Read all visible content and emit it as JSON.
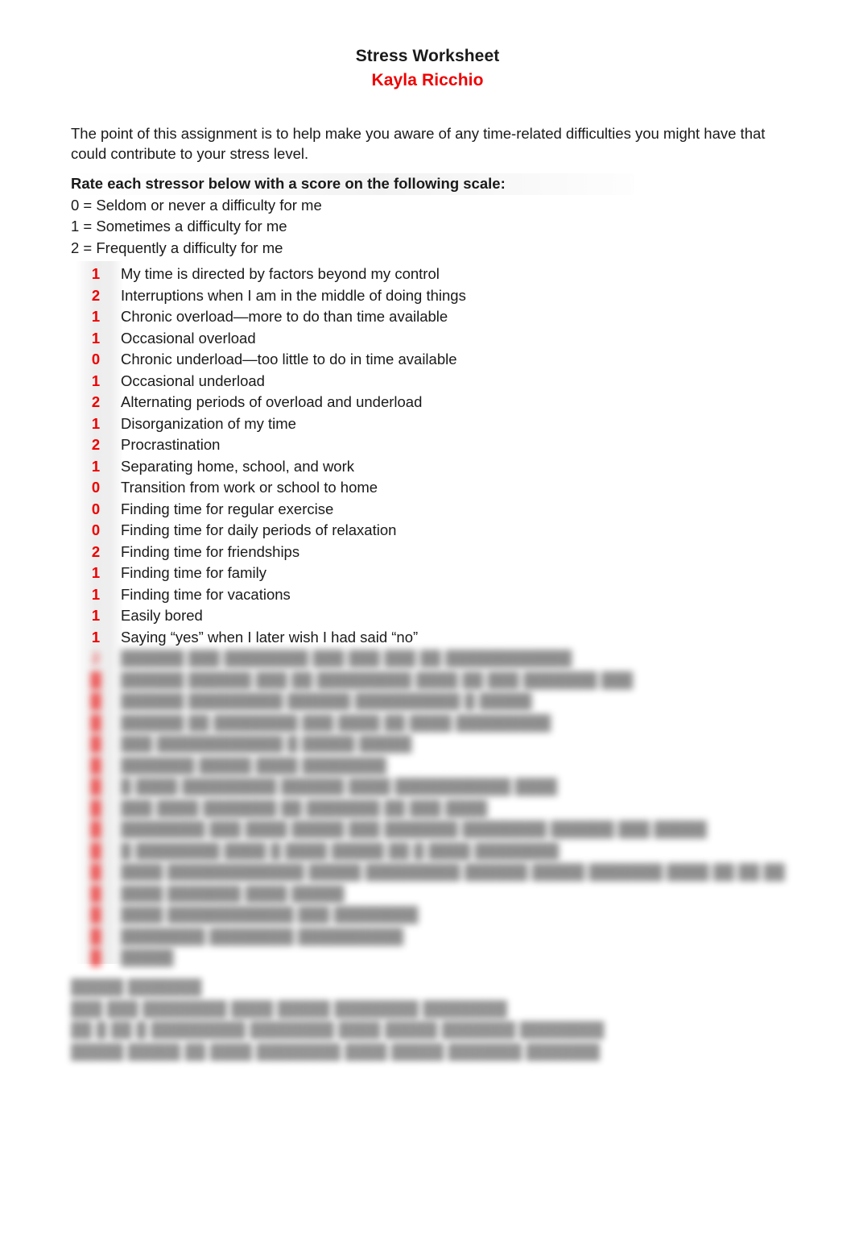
{
  "document": {
    "title": "Stress Worksheet",
    "author": "Kayla Ricchio",
    "intro": "The point of this assignment is to help make you aware of any time-related difficulties you might have that could contribute to your stress level.",
    "scale": {
      "heading": "Rate each stressor below with a score on the following scale:",
      "options": [
        "0 = Seldom or never a difficulty for me",
        "1 = Sometimes a difficulty for me",
        "2 = Frequently a difficulty for me"
      ]
    },
    "colors": {
      "score_red": "#ee0000",
      "author_red": "#ee0000",
      "body_text": "#1a1a1a",
      "page_background": "#ffffff",
      "score_column_shade": "#e7e7e7"
    },
    "stressors": [
      {
        "score": "1",
        "label": "My time is directed by factors beyond my control",
        "redacted": false
      },
      {
        "score": "2",
        "label": "Interruptions when I am in the middle of doing things",
        "redacted": false
      },
      {
        "score": "1",
        "label": "Chronic overload—more to do than time available",
        "redacted": false
      },
      {
        "score": "1",
        "label": "Occasional overload",
        "redacted": false
      },
      {
        "score": "0",
        "label": "Chronic underload—too little to do in time available",
        "redacted": false
      },
      {
        "score": "1",
        "label": "Occasional underload",
        "redacted": false
      },
      {
        "score": "2",
        "label": "Alternating periods of overload and underload",
        "redacted": false
      },
      {
        "score": "1",
        "label": "Disorganization of my time",
        "redacted": false
      },
      {
        "score": "2",
        "label": "Procrastination",
        "redacted": false
      },
      {
        "score": "1",
        "label": "Separating home, school, and work",
        "redacted": false
      },
      {
        "score": "0",
        "label": "Transition from work or school to home",
        "redacted": false
      },
      {
        "score": "0",
        "label": "Finding time for regular exercise",
        "redacted": false
      },
      {
        "score": "0",
        "label": "Finding time for daily periods of relaxation",
        "redacted": false
      },
      {
        "score": "2",
        "label": "Finding time for friendships",
        "redacted": false
      },
      {
        "score": "1",
        "label": "Finding time for family",
        "redacted": false
      },
      {
        "score": "1",
        "label": "Finding time for vacations",
        "redacted": false
      },
      {
        "score": "1",
        "label": "Easily bored",
        "redacted": false
      },
      {
        "score": "1",
        "label": "Saying “yes” when I later wish I had said “no”",
        "redacted": false
      },
      {
        "score": "2",
        "label": "██████ ███ ████████ ███ ███ ███ ██ ████████████",
        "redacted": true
      },
      {
        "score": "█",
        "label": "██████ ██████ ███ ██ █████████ ████ ██ ███ ███████ ███",
        "redacted": true
      },
      {
        "score": "█",
        "label": "██████ █████████ ██████ ██████████ █ █████",
        "redacted": true
      },
      {
        "score": "█",
        "label": "██████ ██ ████████ ███ ████ ██ ████ █████████",
        "redacted": true
      },
      {
        "score": "█",
        "label": "███ ████████████ █ █████ █████",
        "redacted": true
      },
      {
        "score": "█",
        "label": "███████ █████ ████ ████████",
        "redacted": true
      },
      {
        "score": "█",
        "label": "█ ████ █████████ ██████ ████ ███████████ ████",
        "redacted": true
      },
      {
        "score": "█",
        "label": "███ ████ ███████ ██ ███████ ██ ███ ████",
        "redacted": true
      },
      {
        "score": "█",
        "label": "████████ ███ ████ █████ ███ ███████ ████████ ██████ ███ █████",
        "redacted": true
      },
      {
        "score": "█",
        "label": "█ ████████ ████ █ ████ █████ ██ █ ████ ████████",
        "redacted": true
      },
      {
        "score": "█",
        "label": "████ █████████████ █████ █████████ ██████ █████ ███████ ████ ██ ██ ██",
        "redacted": true
      },
      {
        "score": "█",
        "label": "████ ███████ ████ █████",
        "redacted": true
      },
      {
        "score": "█",
        "label": "████ ████████████ ███ ████████",
        "redacted": true
      },
      {
        "score": "█",
        "label": "████████ ████████ ██████████",
        "redacted": true
      },
      {
        "score": "█",
        "label": "█████",
        "redacted": true
      }
    ],
    "scoring_legend": {
      "heading": "█████ ███████",
      "lines": [
        "███ ███ ████████ ████ █████ ████████ ████████",
        "██ █ ██ █ █████████ ████████ ████ █████ ███████ ████████",
        "█████ █████ ██ ████ ████████ ████ █████ ███████ ███████"
      ]
    }
  }
}
